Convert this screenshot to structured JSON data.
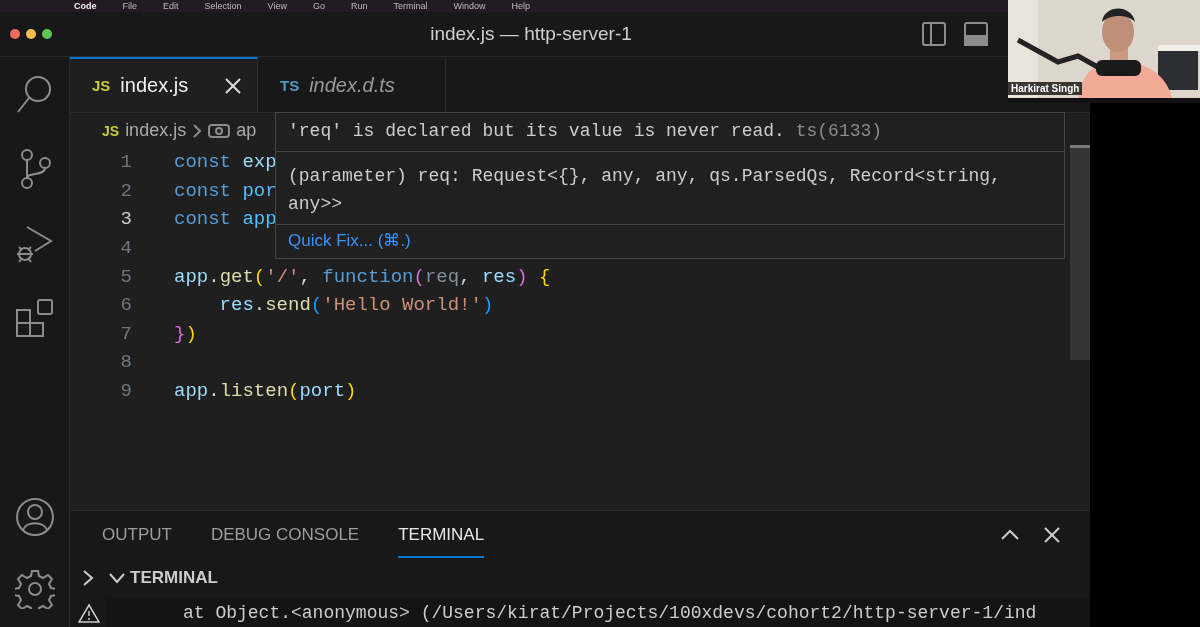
{
  "menu_bar": {
    "items": [
      "Code",
      "File",
      "Edit",
      "Selection",
      "View",
      "Go",
      "Run",
      "Terminal",
      "Window",
      "Help"
    ]
  },
  "window": {
    "title": "index.js — http-server-1"
  },
  "tabs": [
    {
      "badge": "JS",
      "label": "index.js",
      "selected": true,
      "preview": false
    },
    {
      "badge": "TS",
      "label": "index.d.ts",
      "selected": false,
      "preview": true
    }
  ],
  "breadcrumbs": {
    "badge": "JS",
    "file": "index.js",
    "symbol": "ap"
  },
  "editor": {
    "lines": [
      {
        "number": "1",
        "active": false,
        "tokens": [
          {
            "kind": "keyword",
            "text": "const "
          },
          {
            "kind": "variable",
            "text": "exp"
          }
        ]
      },
      {
        "number": "2",
        "active": false,
        "tokens": [
          {
            "kind": "keyword",
            "text": "const "
          },
          {
            "kind": "constant",
            "text": "por"
          }
        ]
      },
      {
        "number": "3",
        "active": true,
        "tokens": [
          {
            "kind": "keyword",
            "text": "const "
          },
          {
            "kind": "constant",
            "text": "app"
          }
        ]
      },
      {
        "number": "4",
        "active": false
      },
      {
        "number": "5",
        "active": false,
        "tokens": [
          {
            "kind": "variable",
            "text": "app"
          },
          {
            "kind": "plain",
            "text": "."
          },
          {
            "kind": "function",
            "text": "get"
          },
          {
            "kind": "bracket1",
            "text": "("
          },
          {
            "kind": "string",
            "text": "'/'"
          },
          {
            "kind": "plain",
            "text": ", "
          },
          {
            "kind": "keyword",
            "text": "function"
          },
          {
            "kind": "bracket2",
            "text": "("
          },
          {
            "kind": "unused",
            "text": "req"
          },
          {
            "kind": "plain",
            "text": ", "
          },
          {
            "kind": "variable",
            "text": "res"
          },
          {
            "kind": "bracket2",
            "text": ")"
          },
          {
            "kind": "bracket1",
            "text": " {"
          }
        ]
      },
      {
        "number": "6",
        "active": false,
        "indent": true,
        "tokens": [
          {
            "kind": "variable",
            "text": "res"
          },
          {
            "kind": "plain",
            "text": "."
          },
          {
            "kind": "function",
            "text": "send"
          },
          {
            "kind": "bracket3",
            "text": "("
          },
          {
            "kind": "string",
            "text": "'Hello World!'"
          },
          {
            "kind": "bracket3",
            "text": ")"
          }
        ]
      },
      {
        "number": "7",
        "active": false,
        "tokens": [
          {
            "kind": "bracket2",
            "text": "}"
          },
          {
            "kind": "bracket1",
            "text": ")"
          }
        ]
      },
      {
        "number": "8",
        "active": false
      },
      {
        "number": "9",
        "active": false,
        "tokens": [
          {
            "kind": "variable",
            "text": "app"
          },
          {
            "kind": "plain",
            "text": "."
          },
          {
            "kind": "function",
            "text": "listen"
          },
          {
            "kind": "bracket1",
            "text": "("
          },
          {
            "kind": "variable",
            "text": "port"
          },
          {
            "kind": "bracket1",
            "text": ")"
          }
        ]
      }
    ]
  },
  "hover": {
    "message": "'req' is declared but its value is never read.",
    "code": "ts(6133)",
    "signature": "(parameter) req: Request<{}, any, any, qs.ParsedQs, Record<string, any>>",
    "action": "Quick Fix... (⌘.)"
  },
  "panel": {
    "tabs": [
      {
        "label": "OUTPUT",
        "selected": false
      },
      {
        "label": "DEBUG CONSOLE",
        "selected": false
      },
      {
        "label": "TERMINAL",
        "selected": true
      }
    ],
    "section": {
      "label": "TERMINAL",
      "expanded": true
    },
    "terminal_line": "at Object.<anonymous> (/Users/kirat/Projects/100xdevs/cohort2/http-server-1/ind"
  },
  "video": {
    "kind": "picture",
    "name": "Harkirat Singh"
  }
}
